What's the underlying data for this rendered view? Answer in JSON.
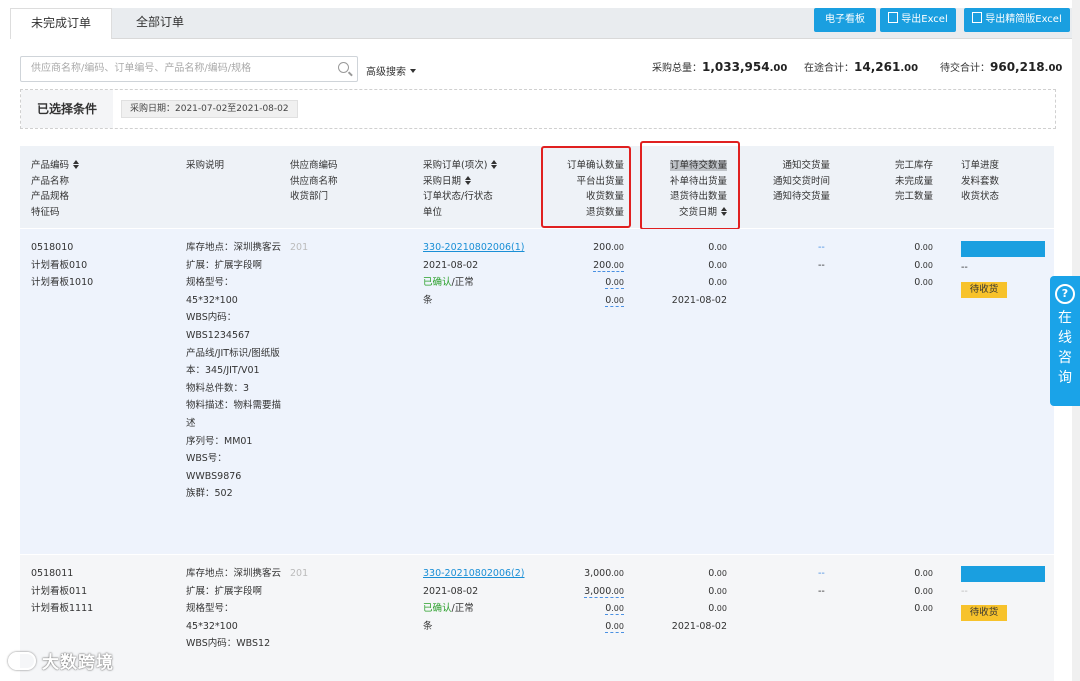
{
  "tabs": [
    "未完成订单",
    "全部订单"
  ],
  "buttons": {
    "board": "电子看板",
    "export": "导出Excel",
    "export_simple": "导出精简版Excel"
  },
  "search": {
    "placeholder": "供应商名称/编码、订单编号、产品名称/编码/规格",
    "advanced": "高级搜索"
  },
  "totals": [
    {
      "label": "采购总量：",
      "value": "1,033,954",
      "dec": ".00"
    },
    {
      "label": "在途合计：",
      "value": "14,261",
      "dec": ".00"
    },
    {
      "label": "待交合计：",
      "value": "960,218",
      "dec": ".00"
    }
  ],
  "conditions": {
    "label": "已选择条件",
    "chip": "采购日期：2021-07-02至2021-08-02"
  },
  "headers": {
    "product": [
      "产品编码",
      "产品名称",
      "产品规格",
      "特征码"
    ],
    "desc": [
      "采购说明"
    ],
    "supplier": [
      "供应商编码",
      "供应商名称",
      "收货部门"
    ],
    "order": [
      "采购订单(项次)",
      "采购日期",
      "订单状态/行状态",
      "单位"
    ],
    "confirm": [
      "订单确认数量",
      "平台出货量",
      "收货数量",
      "退货数量"
    ],
    "pending": [
      "订单待交数量",
      "补单待出货量",
      "退货待出数量",
      "交货日期"
    ],
    "notify": [
      "通知交货量",
      "通知交货时间",
      "通知待交货量"
    ],
    "finish": [
      "完工库存",
      "未完成量",
      "完工数量"
    ],
    "progress": [
      "订单进度",
      "发料套数",
      "收货状态"
    ]
  },
  "rows": [
    {
      "product": [
        "0518010",
        "计划看板010",
        "计划看板1010"
      ],
      "desc": [
        "库存地点：深圳携客云",
        "扩展：扩展字段啊",
        "规格型号：45*32*100",
        "WBS内码：WBS1234567",
        "产品线/JIT标识/图纸版本：345/JIT/V01",
        "物料总件数：3",
        "物料描述：物料需要描述",
        "序列号：MM01",
        "WBS号：WWBS9876",
        "族群：502"
      ],
      "supplier": "201",
      "order_no": "330-20210802006(1)",
      "order_date": "2021-08-02",
      "status_confirmed": "已确认",
      "status_normal": "/正常",
      "unit": "条",
      "confirm": [
        "200",
        "200",
        "0",
        "0"
      ],
      "pending": [
        "0",
        "0",
        "0",
        "2021-08-02"
      ],
      "notify": [
        "--",
        "--"
      ],
      "finish": [
        "0",
        "0",
        "0"
      ],
      "progress": 100,
      "kits": "--",
      "receipt": "待收货"
    },
    {
      "product": [
        "0518011",
        "计划看板011",
        "计划看板1111"
      ],
      "desc": [
        "库存地点：深圳携客云",
        "扩展：扩展字段啊",
        "规格型号：45*32*100",
        "WBS内码：WBS12"
      ],
      "supplier": "201",
      "order_no": "330-20210802006(2)",
      "order_date": "2021-08-02",
      "status_confirmed": "已确认",
      "status_normal": "/正常",
      "unit": "条",
      "confirm": [
        "3,000",
        "3,000",
        "0",
        "0"
      ],
      "pending": [
        "0",
        "0",
        "0",
        "2021-08-02"
      ],
      "notify": [
        "--",
        "--"
      ],
      "finish": [
        "0",
        "0",
        "0"
      ],
      "progress": 100,
      "kits": "--",
      "receipt": "待收货"
    }
  ],
  "decimal": ".00",
  "float_widget": {
    "icon": "?",
    "text": [
      "在",
      "线",
      "咨",
      "询"
    ]
  },
  "watermark": "大数跨境",
  "colors": {
    "accent": "#1a9fe0",
    "highlight_box": "#e02020",
    "badge": "#f7c22b",
    "confirmed": "#2aa02a"
  }
}
